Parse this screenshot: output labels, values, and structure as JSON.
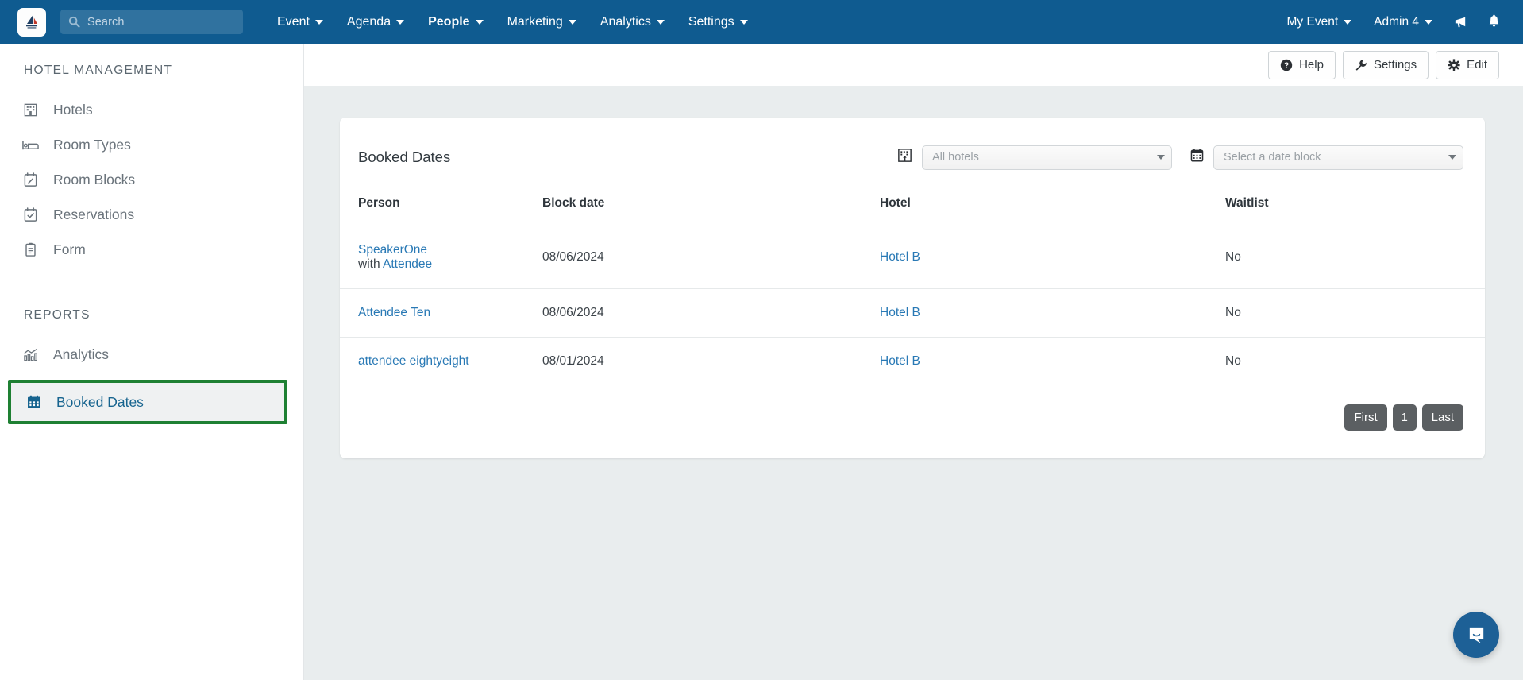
{
  "topnav": {
    "logo_name": "app-logo",
    "search": {
      "placeholder": "Search",
      "value": ""
    },
    "items": [
      {
        "label": "Event",
        "active": false
      },
      {
        "label": "Agenda",
        "active": false
      },
      {
        "label": "People",
        "active": true
      },
      {
        "label": "Marketing",
        "active": false
      },
      {
        "label": "Analytics",
        "active": false
      },
      {
        "label": "Settings",
        "active": false
      }
    ],
    "right": {
      "event_label": "My Event",
      "admin_label": "Admin 4",
      "announce_icon": "megaphone-icon",
      "bell_icon": "bell-icon"
    }
  },
  "sidebar": {
    "sections": [
      {
        "title": "HOTEL MANAGEMENT",
        "items": [
          {
            "label": "Hotels",
            "icon": "hotel-icon"
          },
          {
            "label": "Room Types",
            "icon": "bed-icon"
          },
          {
            "label": "Room Blocks",
            "icon": "calendar-edit-icon"
          },
          {
            "label": "Reservations",
            "icon": "calendar-check-icon"
          },
          {
            "label": "Form",
            "icon": "clipboard-icon"
          }
        ]
      },
      {
        "title": "REPORTS",
        "items": [
          {
            "label": "Analytics",
            "icon": "chart-icon",
            "selected": false
          },
          {
            "label": "Booked Dates",
            "icon": "calendar-icon",
            "selected": true
          }
        ]
      }
    ]
  },
  "actions": {
    "help_label": "Help",
    "settings_label": "Settings",
    "edit_label": "Edit"
  },
  "card": {
    "title": "Booked Dates",
    "hotel_filter": {
      "icon": "hotel-icon",
      "value": "All hotels"
    },
    "date_filter": {
      "icon": "calendar-icon",
      "value": "Select a date block"
    },
    "columns": [
      "Person",
      "Block date",
      "Hotel",
      "Waitlist"
    ],
    "rows": [
      {
        "person": "SpeakerOne",
        "person_with_prefix": "with ",
        "person_with": "Attendee",
        "block_date": "08/06/2024",
        "hotel": "Hotel B",
        "waitlist": "No"
      },
      {
        "person": "Attendee Ten",
        "person_with_prefix": "",
        "person_with": "",
        "block_date": "08/06/2024",
        "hotel": "Hotel B",
        "waitlist": "No"
      },
      {
        "person": "attendee eightyeight",
        "person_with_prefix": "",
        "person_with": "",
        "block_date": "08/01/2024",
        "hotel": "Hotel B",
        "waitlist": "No"
      }
    ],
    "pagination": {
      "first": "First",
      "current": "1",
      "last": "Last"
    }
  },
  "chat": {
    "icon": "chat-bubble-icon"
  },
  "colors": {
    "nav_blue": "#0f5b90",
    "link_blue": "#2979b5",
    "highlight_green": "#1e8033",
    "content_bg": "#e9edee",
    "pager_gray": "#5b5f62"
  }
}
